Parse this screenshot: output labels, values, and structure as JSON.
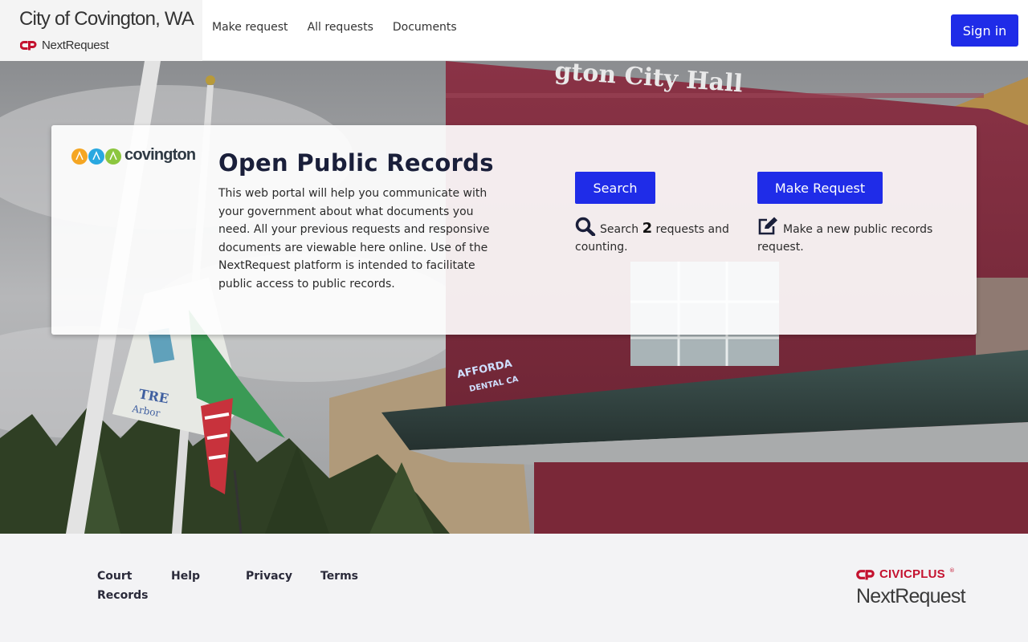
{
  "header": {
    "city_title": "City of Covington, WA",
    "product_name": "NextRequest",
    "nav": [
      "Make request",
      "All requests",
      "Documents"
    ],
    "sign_in_label": "Sign in"
  },
  "hero": {
    "building_sign": "gton City Hall",
    "storefront_sign_1": "AFFORDA",
    "storefront_sign_2": "DENTAL CA",
    "flag_text_1": "TRE",
    "flag_text_2": "Arbor"
  },
  "card": {
    "logo_text": "covington",
    "title": "Open Public Records",
    "description": "This web portal will help you communicate with your government about what documents you need. All your previous requests and responsive documents are viewable here online. Use of the NextRequest platform is intended to facilitate public access to public records.",
    "search_button": "Search",
    "search_desc_before": "Search",
    "search_count": "2",
    "search_desc_after": "requests and counting.",
    "request_button": "Make Request",
    "request_desc": "Make a new public records request."
  },
  "footer": {
    "links": [
      "Court Records",
      "Help",
      "Privacy",
      "Terms"
    ],
    "civicplus_label": "CIVICPLUS",
    "trademark": "®",
    "nextrequest_label": "NextRequest"
  },
  "colors": {
    "primary_button": "#1f2ce8",
    "civicplus_red": "#c4122f",
    "title_navy": "#1a1f3a"
  },
  "icons": [
    "civicplus-logo-icon",
    "search-icon",
    "edit-icon",
    "covington-logo-icon"
  ]
}
